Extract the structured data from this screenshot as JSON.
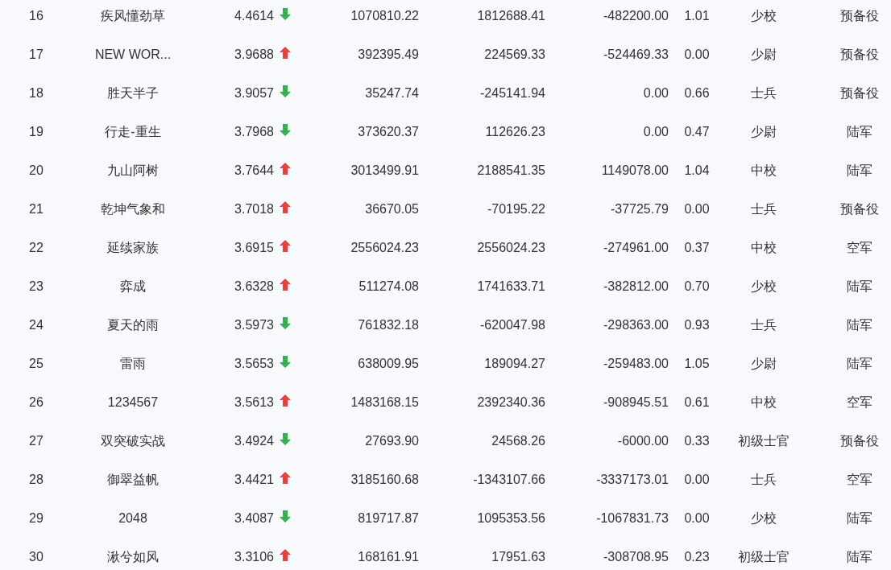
{
  "table": {
    "rows": [
      {
        "rank": "16",
        "name": "疾风懂劲草",
        "score": "4.4614",
        "rising": false,
        "col_4": "1070810.22",
        "col_5": "1812688.41",
        "col_6": "-482200.00",
        "col_7": "1.01",
        "rank_title": "少校",
        "branch": "预备役"
      },
      {
        "rank": "17",
        "name": "NEW WOR...",
        "score": "3.9688",
        "rising": true,
        "col_4": "392395.49",
        "col_5": "224569.33",
        "col_6": "-524469.33",
        "col_7": "0.00",
        "rank_title": "少尉",
        "branch": "预备役"
      },
      {
        "rank": "18",
        "name": "胜天半子",
        "score": "3.9057",
        "rising": false,
        "col_4": "35247.74",
        "col_5": "-245141.94",
        "col_6": "0.00",
        "col_7": "0.66",
        "rank_title": "士兵",
        "branch": "预备役"
      },
      {
        "rank": "19",
        "name": "行走-重生",
        "score": "3.7968",
        "rising": false,
        "col_4": "373620.37",
        "col_5": "112626.23",
        "col_6": "0.00",
        "col_7": "0.47",
        "rank_title": "少尉",
        "branch": "陆军"
      },
      {
        "rank": "20",
        "name": "九山阿树",
        "score": "3.7644",
        "rising": true,
        "col_4": "3013499.91",
        "col_5": "2188541.35",
        "col_6": "1149078.00",
        "col_7": "1.04",
        "rank_title": "中校",
        "branch": "陆军"
      },
      {
        "rank": "21",
        "name": "乾坤气象和",
        "score": "3.7018",
        "rising": true,
        "col_4": "36670.05",
        "col_5": "-70195.22",
        "col_6": "-37725.79",
        "col_7": "0.00",
        "rank_title": "士兵",
        "branch": "预备役"
      },
      {
        "rank": "22",
        "name": "延续家族",
        "score": "3.6915",
        "rising": true,
        "col_4": "2556024.23",
        "col_5": "2556024.23",
        "col_6": "-274961.00",
        "col_7": "0.37",
        "rank_title": "中校",
        "branch": "空军"
      },
      {
        "rank": "23",
        "name": "弈成",
        "score": "3.6328",
        "rising": true,
        "col_4": "511274.08",
        "col_5": "1741633.71",
        "col_6": "-382812.00",
        "col_7": "0.70",
        "rank_title": "少校",
        "branch": "陆军"
      },
      {
        "rank": "24",
        "name": "夏天的雨",
        "score": "3.5973",
        "rising": false,
        "col_4": "761832.18",
        "col_5": "-620047.98",
        "col_6": "-298363.00",
        "col_7": "0.93",
        "rank_title": "士兵",
        "branch": "陆军"
      },
      {
        "rank": "25",
        "name": "雷雨",
        "score": "3.5653",
        "rising": false,
        "col_4": "638009.95",
        "col_5": "189094.27",
        "col_6": "-259483.00",
        "col_7": "1.05",
        "rank_title": "少尉",
        "branch": "陆军"
      },
      {
        "rank": "26",
        "name": "1234567",
        "score": "3.5613",
        "rising": true,
        "col_4": "1483168.15",
        "col_5": "2392340.36",
        "col_6": "-908945.51",
        "col_7": "0.61",
        "rank_title": "中校",
        "branch": "空军"
      },
      {
        "rank": "27",
        "name": "双突破实战",
        "score": "3.4924",
        "rising": false,
        "col_4": "27693.90",
        "col_5": "24568.26",
        "col_6": "-6000.00",
        "col_7": "0.33",
        "rank_title": "初级士官",
        "branch": "预备役"
      },
      {
        "rank": "28",
        "name": "御翠益帆",
        "score": "3.4421",
        "rising": true,
        "col_4": "3185160.68",
        "col_5": "-1343107.66",
        "col_6": "-3337173.01",
        "col_7": "0.00",
        "rank_title": "士兵",
        "branch": "空军"
      },
      {
        "rank": "29",
        "name": "2048",
        "score": "3.4087",
        "rising": false,
        "col_4": "819717.87",
        "col_5": "1095353.56",
        "col_6": "-1067831.73",
        "col_7": "0.00",
        "rank_title": "少校",
        "branch": "陆军"
      },
      {
        "rank": "30",
        "name": "湫兮如风",
        "score": "3.3106",
        "rising": true,
        "col_4": "168161.91",
        "col_5": "17951.63",
        "col_6": "-308708.95",
        "col_7": "0.23",
        "rank_title": "初级士官",
        "branch": "陆军"
      }
    ]
  }
}
